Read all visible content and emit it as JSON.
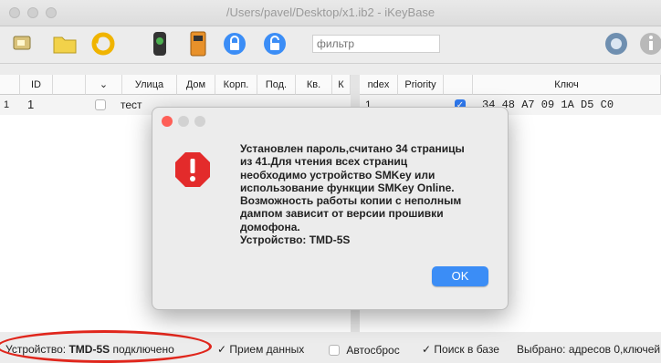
{
  "window": {
    "title": "/Users/pavel/Desktop/x1.ib2 - iKeyBase"
  },
  "toolbar": {
    "filter_placeholder": "фильтр",
    "icons": [
      "device-icon",
      "folder-icon",
      "refresh-icon",
      "reader-icon",
      "intercom-icon",
      "lock-icon",
      "lock-icon",
      "sync-icon",
      "info-icon"
    ]
  },
  "left_table": {
    "headers": [
      "ID",
      "",
      "Улица",
      "Дом",
      "Корп.",
      "Под.",
      "Кв.",
      "К"
    ],
    "row": {
      "num": "1",
      "id": "1",
      "street": "тест"
    }
  },
  "right_table": {
    "headers": [
      "ndex",
      "Priority",
      "",
      "Ключ"
    ],
    "row": {
      "index": "1",
      "key": "34 48 A7 09 1A D5 C0"
    }
  },
  "dialog": {
    "message_lines": [
      "Установлен пароль,считано 34 страницы",
      "из 41.Для чтения всех страниц",
      "необходимо устройство SMKey или",
      "использование функции SMKey Online.",
      "Возможность работы копии с неполным",
      "дампом зависит от версии прошивки",
      "домофона.",
      "Устройство: TMD-5S"
    ],
    "ok_label": "OK"
  },
  "status": {
    "device_prefix": "Устройство:",
    "device_name": "TMD-5S",
    "device_state": "подключено",
    "receive_label": "Прием данных",
    "receive_checked": true,
    "autoreset_label": "Автосброс",
    "autoreset_checked": false,
    "search_label": "Поиск в базе",
    "search_checked": true,
    "selected_text": "Выбрано: адресов 0,ключей"
  },
  "colors": {
    "accent": "#3b8df6",
    "annotation": "#e0261c",
    "warning": "#e32b2b"
  }
}
